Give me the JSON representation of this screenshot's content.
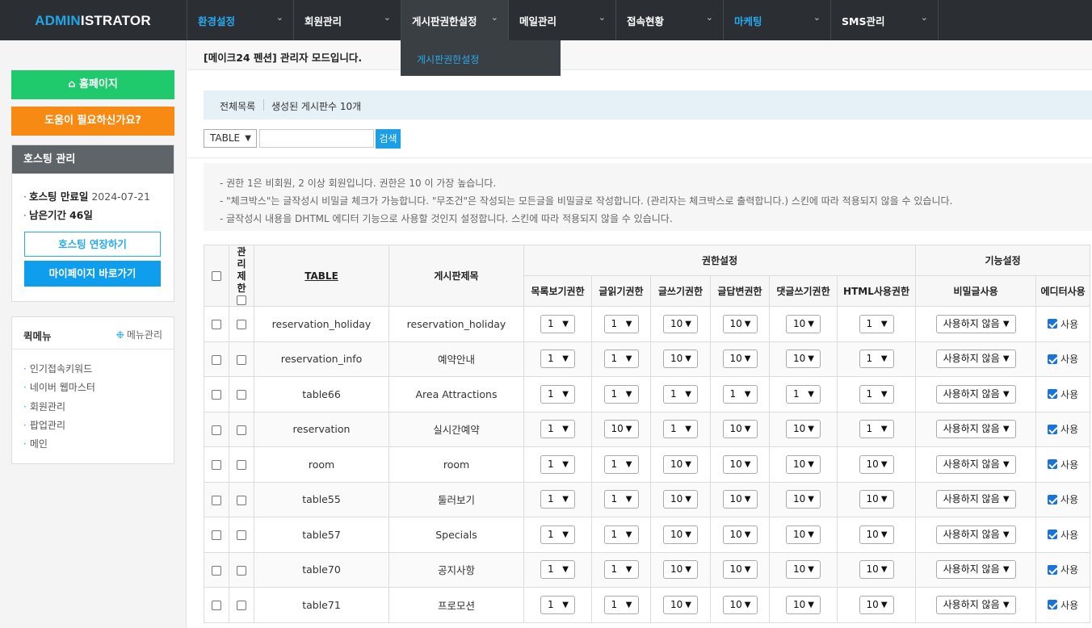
{
  "brand": {
    "part1": "ADMIN",
    "part2": "ISTRATOR"
  },
  "nav": [
    {
      "label": "환경설정",
      "color": "#25aaf0"
    },
    {
      "label": "회원관리"
    },
    {
      "label": "게시판권한설정",
      "open": true
    },
    {
      "label": "메일관리"
    },
    {
      "label": "접속현황"
    },
    {
      "label": "마케팅",
      "color": "#25aaf0"
    },
    {
      "label": "SMS관리"
    }
  ],
  "dropdown": {
    "item": "게시판권한설정"
  },
  "sidebar": {
    "home": "홈페이지",
    "help": "도움이 필요하신가요?",
    "hosting": {
      "title": "호스팅 관리",
      "expiry_label": "호스팅 만료일",
      "expiry_value": "2024-07-21",
      "remain_label": "남은기간",
      "remain_value": "46일",
      "extend_btn": "호스팅 연장하기",
      "mypage_btn": "마이페이지 바로가기"
    },
    "quick": {
      "title": "퀵메뉴",
      "manage": "메뉴관리",
      "items": [
        "인기접속키워드",
        "네이버 웹마스터",
        "회원관리",
        "팝업관리",
        "메인"
      ]
    }
  },
  "main": {
    "mode_text": "[메이크24 펜션] 관리자 모드입니다.",
    "info_all": "전체목록",
    "info_count": "생성된 게시판수 10개",
    "search_select": "TABLE",
    "search_value": "",
    "search_btn": "검색",
    "notes": [
      "- 권한 1은 비회원, 2 이상 회원입니다. 권한은 10 이 가장 높습니다.",
      "- \"체크박스\"는 글작성시 비밀글 체크가 가능합니다. \"무조건\"은 작성되는 모든글을 비밀글로 작성합니다. (관리자는 체크박스로 출력합니다.) 스킨에 따라 적용되지 않을 수 있습니다.",
      "- 글작성시 내용을 DHTML 에디터 기능으로 사용할 것인지 설정합니다. 스킨에 따라 적용되지 않을 수 있습니다."
    ]
  },
  "table": {
    "headers": {
      "restrict": "관리 제한",
      "table": "TABLE",
      "title": "게시판제목",
      "perm_group": "권한설정",
      "func_group": "기능설정",
      "list": "목록보기권한",
      "read": "글읽기권한",
      "write": "글쓰기권한",
      "reply": "글답변권한",
      "comment": "댓글쓰기권한",
      "html": "HTML사용권한",
      "secret": "비밀글사용",
      "editor": "에디터사용"
    },
    "secret_option": "사용하지 않음",
    "editor_label": "사용",
    "rows": [
      {
        "table": "reservation_holiday",
        "title": "reservation_holiday",
        "list": "1",
        "read": "1",
        "write": "10",
        "reply": "10",
        "comment": "10",
        "html": "1"
      },
      {
        "table": "reservation_info",
        "title": "예약안내",
        "list": "1",
        "read": "1",
        "write": "10",
        "reply": "10",
        "comment": "10",
        "html": "1"
      },
      {
        "table": "table66",
        "title": "Area Attractions",
        "list": "1",
        "read": "1",
        "write": "1",
        "reply": "1",
        "comment": "1",
        "html": "1"
      },
      {
        "table": "reservation",
        "title": "실시간예약",
        "list": "1",
        "read": "10",
        "write": "1",
        "reply": "10",
        "comment": "10",
        "html": "1"
      },
      {
        "table": "room",
        "title": "room",
        "list": "1",
        "read": "1",
        "write": "10",
        "reply": "10",
        "comment": "10",
        "html": "10"
      },
      {
        "table": "table55",
        "title": "둘러보기",
        "list": "1",
        "read": "1",
        "write": "10",
        "reply": "10",
        "comment": "10",
        "html": "10"
      },
      {
        "table": "table57",
        "title": "Specials",
        "list": "1",
        "read": "1",
        "write": "10",
        "reply": "10",
        "comment": "10",
        "html": "10"
      },
      {
        "table": "table70",
        "title": "공지사항",
        "list": "1",
        "read": "1",
        "write": "10",
        "reply": "10",
        "comment": "10",
        "html": "10"
      },
      {
        "table": "table71",
        "title": "프로모션",
        "list": "1",
        "read": "1",
        "write": "10",
        "reply": "10",
        "comment": "10",
        "html": "10"
      }
    ]
  }
}
